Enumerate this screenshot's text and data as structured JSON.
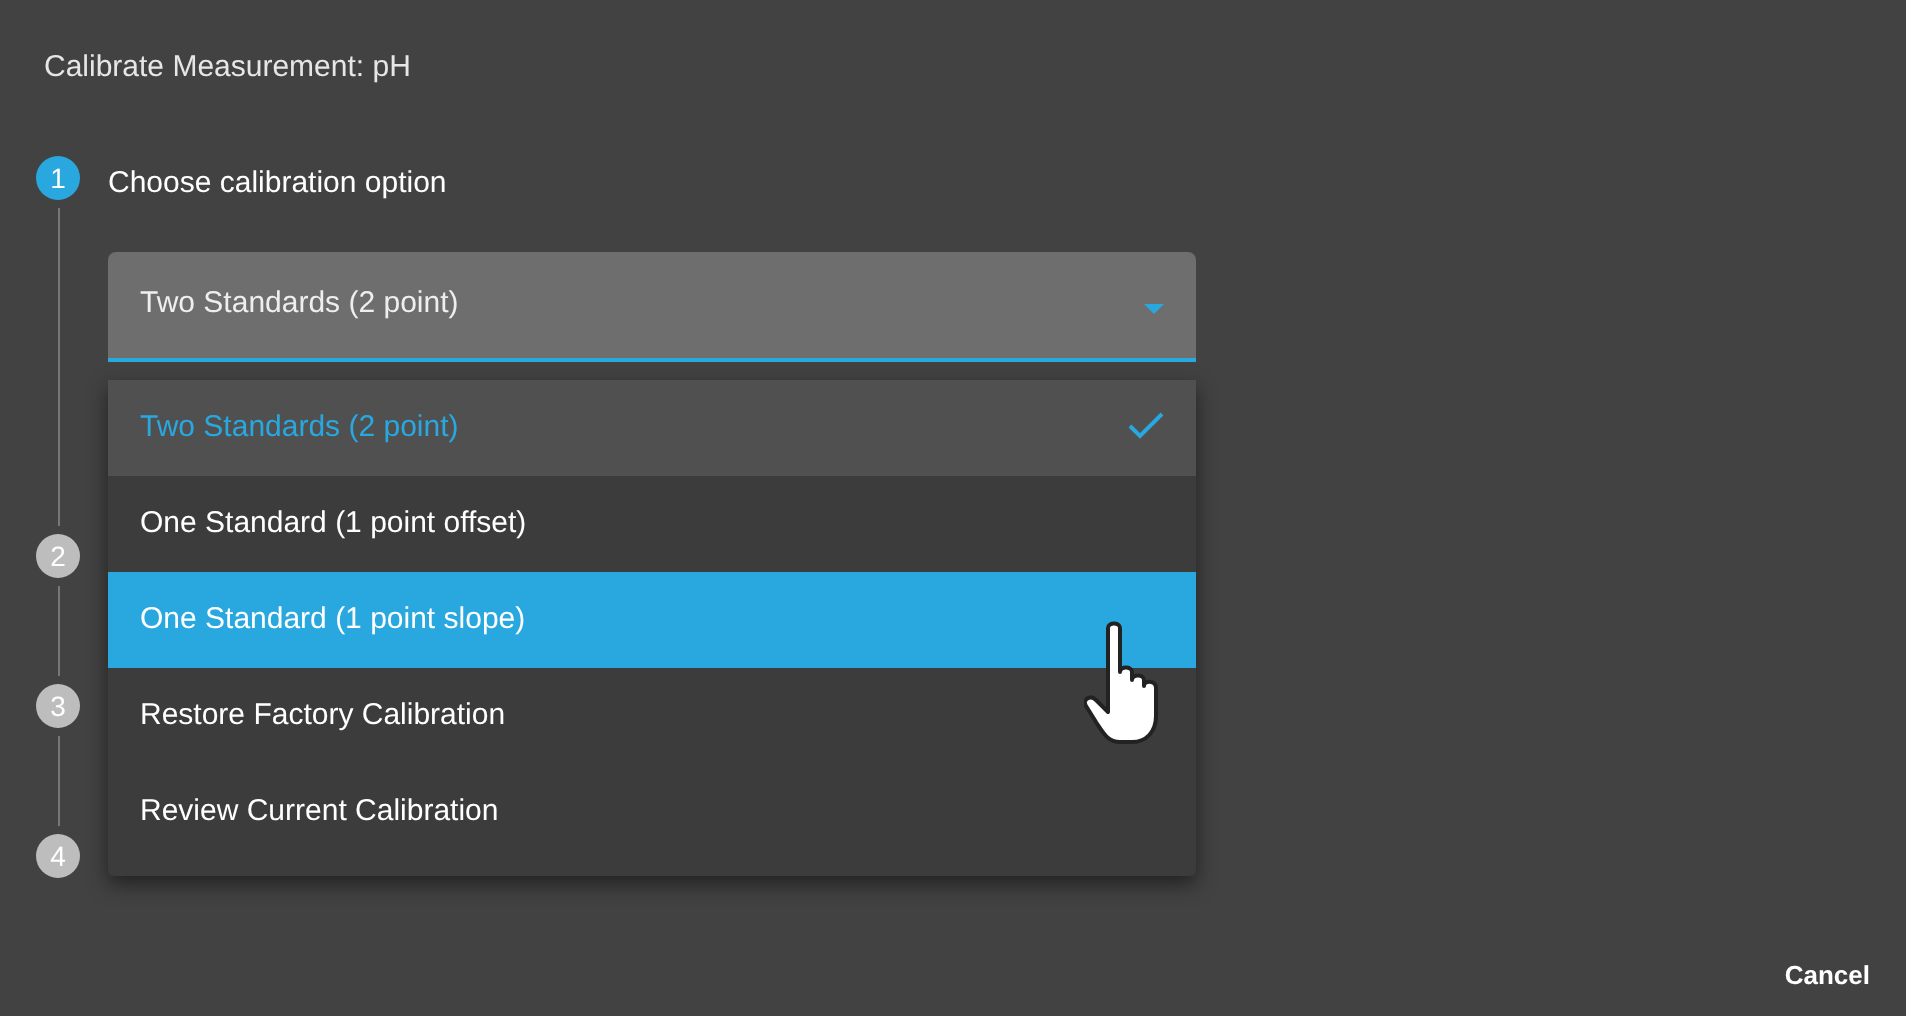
{
  "dialog": {
    "title": "Calibrate Measurement: pH"
  },
  "steps": [
    {
      "number": "1",
      "label": "Choose calibration option",
      "active": true
    },
    {
      "number": "2",
      "active": false
    },
    {
      "number": "3",
      "active": false
    },
    {
      "number": "4",
      "active": false
    }
  ],
  "select": {
    "value": "Two Standards (2 point)",
    "expanded": true
  },
  "options": [
    {
      "label": "Two Standards (2 point)",
      "selected": true,
      "hovered": false
    },
    {
      "label": "One Standard (1 point offset)",
      "selected": false,
      "hovered": false
    },
    {
      "label": "One Standard (1 point slope)",
      "selected": false,
      "hovered": true
    },
    {
      "label": "Restore Factory Calibration",
      "selected": false,
      "hovered": false
    },
    {
      "label": "Review Current Calibration",
      "selected": false,
      "hovered": false
    }
  ],
  "buttons": [
    {
      "label": "Cancel"
    }
  ]
}
